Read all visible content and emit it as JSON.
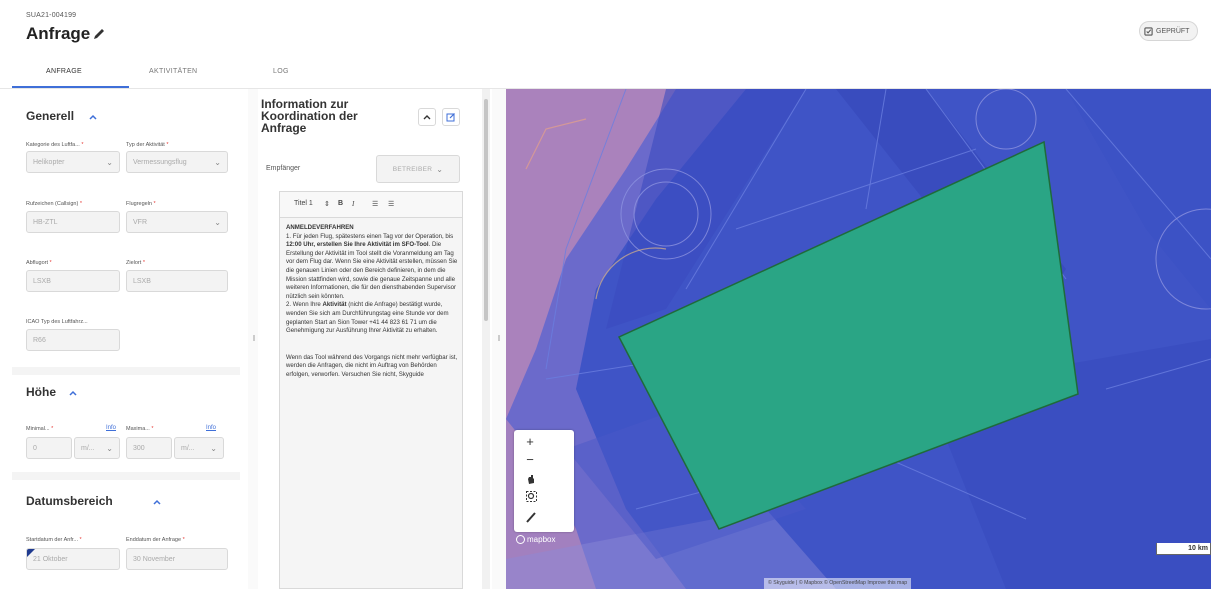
{
  "header": {
    "request_id": "SUA21-004199",
    "title": "Anfrage",
    "status_label": "GEPRÜFT",
    "tabs": [
      {
        "label": "ANFRAGE"
      },
      {
        "label": "AKTIVITÄTEN"
      },
      {
        "label": "LOG"
      }
    ]
  },
  "form": {
    "general": {
      "title": "Generell",
      "aircraft_category_label": "Kategorie des Luftfa...",
      "aircraft_category_value": "Helikopter",
      "activity_type_label": "Typ der Aktivität",
      "activity_type_value": "Vermessungsflug",
      "callsign_label": "Rufzeichen (Callsign)",
      "callsign_value": "HB-ZTL",
      "flight_rules_label": "Flugregeln",
      "flight_rules_value": "VFR",
      "departure_label": "Abflugort",
      "departure_value": "LSXB",
      "destination_label": "Zielort",
      "destination_value": "LSXB",
      "icao_type_label": "ICAO Typ des Luftfahrz...",
      "icao_type_value": "R66"
    },
    "height": {
      "title": "Höhe",
      "min_label": "Minimal...",
      "min_info": "Info",
      "min_value": "0",
      "min_unit": "m/...",
      "max_label": "Maxima...",
      "max_info": "Info",
      "max_value": "300",
      "max_unit": "m/..."
    },
    "date_range": {
      "title": "Datumsbereich",
      "start_label": "Startdatum der Anfr...",
      "start_value": "21 Oktober",
      "end_label": "Enddatum der Anfrage",
      "end_value": "30 November"
    }
  },
  "info_panel": {
    "title": "Information zur Koordination der Anfrage",
    "recipient_label": "Empfänger",
    "recipient_value": "BETREIBER",
    "toolbar": {
      "heading_select": "Titel 1",
      "bold": "B",
      "italic": "I"
    },
    "content": {
      "heading": "ANMELDEVERFAHREN",
      "p1_a": "1. Für jeden Flug, spätestens einen Tag vor der Operation, bis ",
      "p1_bold1": "12:00 Uhr, erstellen Sie Ihre Aktivität im SFO-Tool",
      "p1_b": ". Die Erstellung der Aktivität im Tool stellt die Voranmeldung am Tag vor dem Flug dar. Wenn Sie eine Aktivität erstellen, müssen Sie die genauen Linien oder den Bereich definieren, in dem die Mission stattfinden wird, sowie die genaue Zeitspanne und alle weiteren Informationen, die für den diensthabenden Supervisor nützlich sein könnten.",
      "p2_a": "2. Wenn Ihre ",
      "p2_bold": "Aktivität",
      "p2_b": " (nicht die Anfrage) bestätigt wurde, wenden Sie sich am Durchführungstag eine Stunde vor dem geplanten Start an Sion Tower +41 44 823 61 71 um die Genehmigung zur Ausführung Ihrer Aktivität zu erhalten.",
      "p3": "Wenn das Tool während des Vorgangs nicht mehr verfügbar ist, werden die Anfragen, die nicht im Auftrag von Behörden erfolgen, verworfen. Versuchen Sie nicht, Skyguide"
    }
  },
  "map": {
    "zoom_in": "+",
    "zoom_out": "−",
    "logo_text": "mapbox",
    "scale_label": "10 km",
    "attribution": "© Skyguide | © Mapbox © OpenStreetMap Improve this map",
    "colors": {
      "airspace": "#3f54c6",
      "terrain": "#c98aa4",
      "activity_area": "#2aa585"
    }
  }
}
